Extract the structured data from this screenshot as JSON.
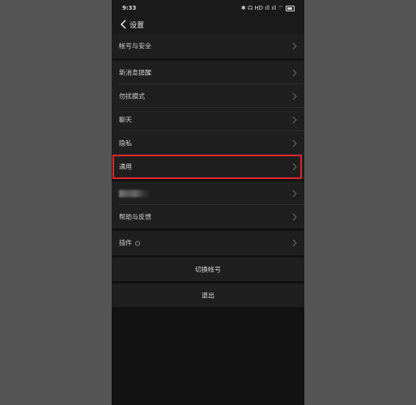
{
  "status_bar": {
    "time": "9:33",
    "icons_text": "✱ ☊ HD ıll ıll ⌔"
  },
  "nav": {
    "title": "设置",
    "back_icon": "chevron-left"
  },
  "settings": {
    "items": [
      {
        "label": "帐号与安全"
      },
      {
        "label": "新消息提醒"
      },
      {
        "label": "勿扰模式"
      },
      {
        "label": "聊天"
      },
      {
        "label": "隐私"
      },
      {
        "label": "通用"
      },
      {
        "label": ""
      },
      {
        "label": "帮助与反馈"
      },
      {
        "label": "插件"
      }
    ]
  },
  "actions": {
    "switch_account": "切换帐号",
    "logout": "退出"
  },
  "colors": {
    "background": "#555555",
    "screen": "#121212",
    "row": "#1f1f1f",
    "highlight": "#e0262a"
  }
}
